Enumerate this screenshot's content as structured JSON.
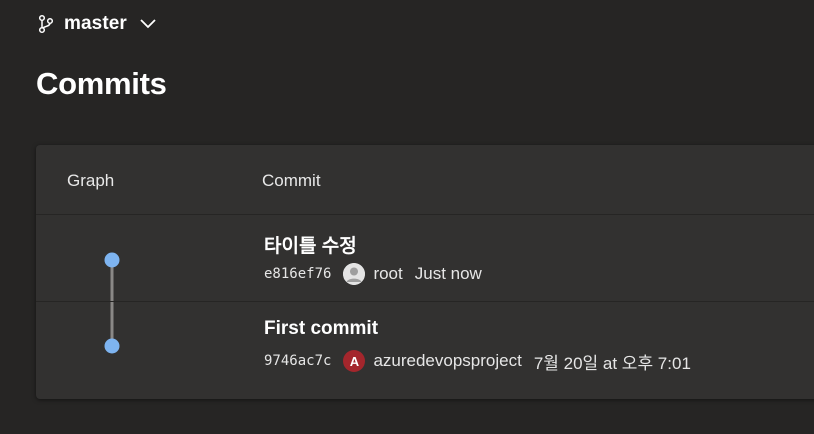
{
  "branch": {
    "name": "master",
    "icon": "git-branch-icon"
  },
  "page": {
    "title": "Commits"
  },
  "table": {
    "columns": {
      "graph": "Graph",
      "commit": "Commit"
    },
    "rows": [
      {
        "message": "타이틀 수정",
        "hash": "e816ef76",
        "author": "root",
        "date": "Just now",
        "avatar": "user-avatar-icon"
      },
      {
        "message": "First commit",
        "hash": "9746ac7c",
        "author": "azuredevopsproject",
        "date": "7월 20일 at 오후 7:01",
        "avatar_letter": "A",
        "avatar_color": "#a4262c"
      }
    ]
  },
  "colors": {
    "background": "#262524",
    "card": "#323130",
    "graph_node": "#7eb4f0",
    "graph_line": "#8a8886"
  }
}
